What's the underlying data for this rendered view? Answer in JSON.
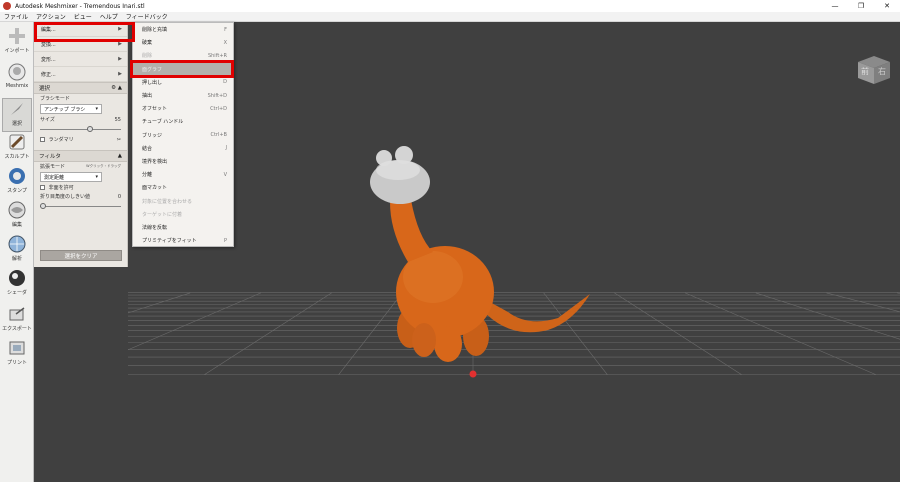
{
  "window": {
    "title": "Autodesk Meshmixer - Tremendous Inari.stl",
    "controls": [
      "—",
      "❐",
      "✕"
    ]
  },
  "menubar": [
    "ファイル",
    "アクション",
    "ビュー",
    "ヘルプ",
    "フィードバック"
  ],
  "toolbar": [
    {
      "label": "インポート",
      "icon": "import-icon"
    },
    {
      "label": "Meshmix",
      "icon": "meshmix-icon"
    },
    {
      "label": "選択",
      "icon": "select-icon"
    },
    {
      "label": "スカルプト",
      "icon": "sculpt-icon"
    },
    {
      "label": "スタンプ",
      "icon": "stamp-icon"
    },
    {
      "label": "編集",
      "icon": "edit-icon"
    },
    {
      "label": "解析",
      "icon": "analysis-icon"
    },
    {
      "label": "シェーダ",
      "icon": "shader-icon"
    },
    {
      "label": "エクスポート",
      "icon": "export-icon"
    },
    {
      "label": "プリント",
      "icon": "print-icon"
    }
  ],
  "panel": {
    "menu": [
      {
        "label": "編集...",
        "arrow": "▶"
      },
      {
        "label": "変換...",
        "arrow": "▶"
      },
      {
        "label": "変形...",
        "arrow": "▶"
      },
      {
        "label": "修正...",
        "arrow": "▶"
      }
    ],
    "select_section": {
      "title": "選択",
      "brush_mode_label": "ブラシモード",
      "brush_mode_value": "アンチップ ブラシ",
      "size_label": "サイズ",
      "size_value": "55",
      "size_level": 0.62,
      "random_label": "ランダマリ"
    },
    "filter_section": {
      "title": "フィルタ",
      "expand_mode_label": "拡張モード",
      "expand_mode_hint": "Wクリック・ドラッグ",
      "expand_mode_value": "測定距離",
      "allow_label": "非面を許可",
      "angle_label": "折り目角度のしきい値",
      "angle_value": "0",
      "angle_level": 0.0
    },
    "clear_button": "選択をクリア"
  },
  "submenu": [
    {
      "label": "削除と充填",
      "shortcut": "F",
      "state": "normal"
    },
    {
      "label": "破棄",
      "shortcut": "X",
      "state": "normal"
    },
    {
      "label": "削除",
      "shortcut": "Shift+R",
      "state": "disabled"
    },
    {
      "label": "面グラフ",
      "shortcut": "",
      "state": "highlight"
    },
    {
      "label": "押し出し",
      "shortcut": "D",
      "state": "normal"
    },
    {
      "label": "抽出",
      "shortcut": "Shift+D",
      "state": "normal"
    },
    {
      "label": "オフセット",
      "shortcut": "Ctrl+D",
      "state": "normal"
    },
    {
      "label": "チューブ ハンドル",
      "shortcut": "",
      "state": "normal"
    },
    {
      "label": "ブリッジ",
      "shortcut": "Ctrl+B",
      "state": "normal"
    },
    {
      "label": "結合",
      "shortcut": "J",
      "state": "normal"
    },
    {
      "label": "境界を検出",
      "shortcut": "",
      "state": "normal"
    },
    {
      "label": "分離",
      "shortcut": "V",
      "state": "normal"
    },
    {
      "label": "面マカット",
      "shortcut": "",
      "state": "normal"
    },
    {
      "label": "対象に位置を合わせる",
      "shortcut": "",
      "state": "disabled"
    },
    {
      "label": "ターゲットに付着",
      "shortcut": "",
      "state": "disabled"
    },
    {
      "label": "法線を反転",
      "shortcut": "",
      "state": "normal"
    },
    {
      "label": "プリミティブをフィット",
      "shortcut": "P",
      "state": "normal"
    }
  ],
  "viewcube": {
    "front": "前",
    "right": "右"
  },
  "colors": {
    "viewport_bg": "#404040",
    "grid": "#6a6a6a",
    "model_orange": "#d8671a",
    "model_gray": "#c9c9c9",
    "highlight_red": "#e00000"
  }
}
